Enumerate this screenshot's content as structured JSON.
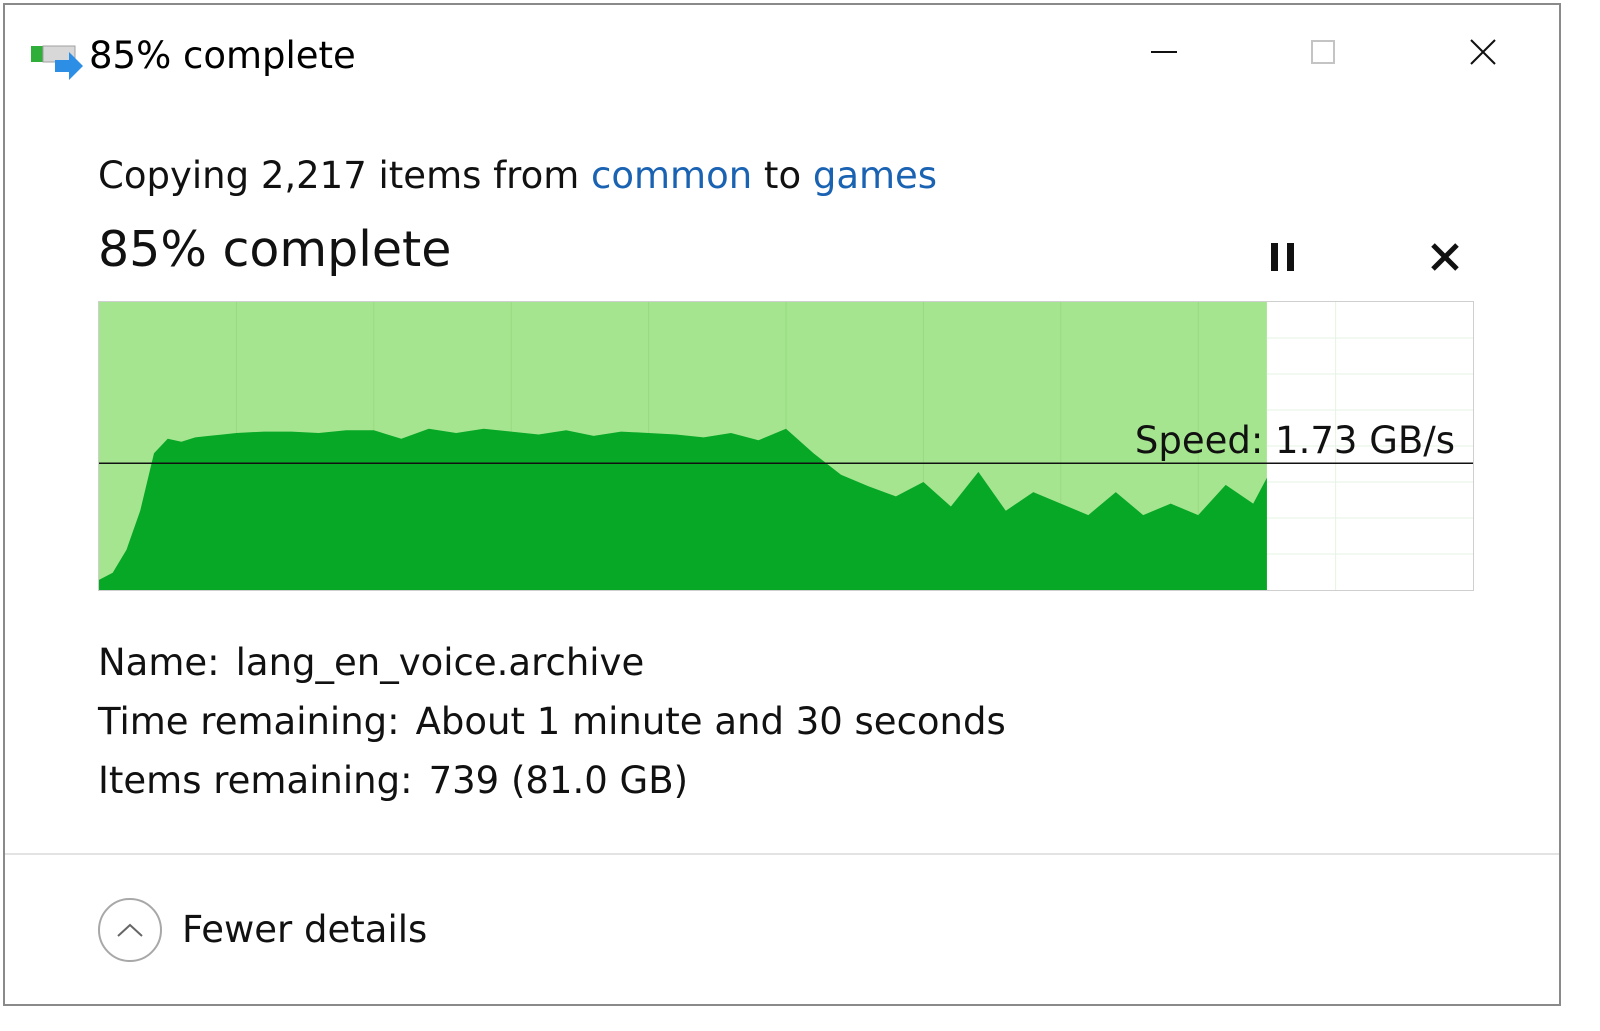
{
  "window": {
    "title": "85% complete",
    "icon": "copy-transfer-icon",
    "controls": {
      "minimize": "minimize-icon",
      "maximize": "maximize-icon",
      "close": "close-icon"
    }
  },
  "summary": {
    "prefix": "Copying 2,217 items from ",
    "source": "common",
    "middle": " to ",
    "destination": "games"
  },
  "progress": {
    "label": "85% complete",
    "percent": 85,
    "pause_icon": "pause-icon",
    "cancel_icon": "cancel-icon"
  },
  "speed": {
    "label": "Speed: 1.73 GB/s"
  },
  "details": {
    "name_label": "Name:",
    "name_value": "lang_en_voice.archive",
    "time_label": "Time remaining:",
    "time_value": "About 1 minute and 30 seconds",
    "items_label": "Items remaining:",
    "items_value": "739 (81.0 GB)"
  },
  "footer": {
    "toggle_label": "Fewer details",
    "toggle_icon": "chevron-up-icon"
  },
  "colors": {
    "progress_fill": "#a6e590",
    "speed_fill": "#06a826",
    "link": "#1a63b3"
  },
  "chart_data": {
    "type": "area",
    "x": [
      0,
      0.01,
      0.02,
      0.03,
      0.04,
      0.05,
      0.06,
      0.07,
      0.08,
      0.09,
      0.1,
      0.12,
      0.14,
      0.16,
      0.18,
      0.2,
      0.22,
      0.24,
      0.26,
      0.28,
      0.3,
      0.32,
      0.34,
      0.36,
      0.38,
      0.4,
      0.42,
      0.44,
      0.46,
      0.48,
      0.5,
      0.52,
      0.54,
      0.56,
      0.58,
      0.6,
      0.62,
      0.64,
      0.66,
      0.68,
      0.7,
      0.72,
      0.74,
      0.76,
      0.78,
      0.8,
      0.82,
      0.84,
      0.85
    ],
    "values": [
      0.07,
      0.12,
      0.28,
      0.55,
      0.95,
      1.05,
      1.03,
      1.06,
      1.07,
      1.08,
      1.09,
      1.1,
      1.1,
      1.09,
      1.11,
      1.11,
      1.05,
      1.12,
      1.09,
      1.12,
      1.1,
      1.08,
      1.11,
      1.07,
      1.1,
      1.09,
      1.08,
      1.06,
      1.09,
      1.04,
      1.12,
      0.95,
      0.8,
      0.72,
      0.65,
      0.75,
      0.58,
      0.82,
      0.55,
      0.68,
      0.6,
      0.52,
      0.68,
      0.52,
      0.6,
      0.52,
      0.73,
      0.6,
      0.78
    ],
    "average": 0.88,
    "xlim": [
      0,
      1
    ],
    "ylim": [
      0,
      2
    ],
    "grid": true
  }
}
